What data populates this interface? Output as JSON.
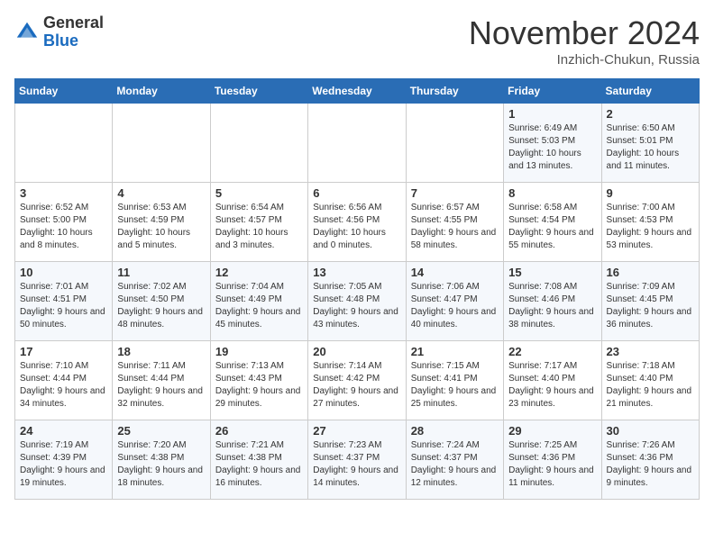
{
  "header": {
    "logo_general": "General",
    "logo_blue": "Blue",
    "month_title": "November 2024",
    "subtitle": "Inzhich-Chukun, Russia"
  },
  "days_of_week": [
    "Sunday",
    "Monday",
    "Tuesday",
    "Wednesday",
    "Thursday",
    "Friday",
    "Saturday"
  ],
  "weeks": [
    [
      {
        "day": "",
        "info": ""
      },
      {
        "day": "",
        "info": ""
      },
      {
        "day": "",
        "info": ""
      },
      {
        "day": "",
        "info": ""
      },
      {
        "day": "",
        "info": ""
      },
      {
        "day": "1",
        "info": "Sunrise: 6:49 AM\nSunset: 5:03 PM\nDaylight: 10 hours and 13 minutes."
      },
      {
        "day": "2",
        "info": "Sunrise: 6:50 AM\nSunset: 5:01 PM\nDaylight: 10 hours and 11 minutes."
      }
    ],
    [
      {
        "day": "3",
        "info": "Sunrise: 6:52 AM\nSunset: 5:00 PM\nDaylight: 10 hours and 8 minutes."
      },
      {
        "day": "4",
        "info": "Sunrise: 6:53 AM\nSunset: 4:59 PM\nDaylight: 10 hours and 5 minutes."
      },
      {
        "day": "5",
        "info": "Sunrise: 6:54 AM\nSunset: 4:57 PM\nDaylight: 10 hours and 3 minutes."
      },
      {
        "day": "6",
        "info": "Sunrise: 6:56 AM\nSunset: 4:56 PM\nDaylight: 10 hours and 0 minutes."
      },
      {
        "day": "7",
        "info": "Sunrise: 6:57 AM\nSunset: 4:55 PM\nDaylight: 9 hours and 58 minutes."
      },
      {
        "day": "8",
        "info": "Sunrise: 6:58 AM\nSunset: 4:54 PM\nDaylight: 9 hours and 55 minutes."
      },
      {
        "day": "9",
        "info": "Sunrise: 7:00 AM\nSunset: 4:53 PM\nDaylight: 9 hours and 53 minutes."
      }
    ],
    [
      {
        "day": "10",
        "info": "Sunrise: 7:01 AM\nSunset: 4:51 PM\nDaylight: 9 hours and 50 minutes."
      },
      {
        "day": "11",
        "info": "Sunrise: 7:02 AM\nSunset: 4:50 PM\nDaylight: 9 hours and 48 minutes."
      },
      {
        "day": "12",
        "info": "Sunrise: 7:04 AM\nSunset: 4:49 PM\nDaylight: 9 hours and 45 minutes."
      },
      {
        "day": "13",
        "info": "Sunrise: 7:05 AM\nSunset: 4:48 PM\nDaylight: 9 hours and 43 minutes."
      },
      {
        "day": "14",
        "info": "Sunrise: 7:06 AM\nSunset: 4:47 PM\nDaylight: 9 hours and 40 minutes."
      },
      {
        "day": "15",
        "info": "Sunrise: 7:08 AM\nSunset: 4:46 PM\nDaylight: 9 hours and 38 minutes."
      },
      {
        "day": "16",
        "info": "Sunrise: 7:09 AM\nSunset: 4:45 PM\nDaylight: 9 hours and 36 minutes."
      }
    ],
    [
      {
        "day": "17",
        "info": "Sunrise: 7:10 AM\nSunset: 4:44 PM\nDaylight: 9 hours and 34 minutes."
      },
      {
        "day": "18",
        "info": "Sunrise: 7:11 AM\nSunset: 4:44 PM\nDaylight: 9 hours and 32 minutes."
      },
      {
        "day": "19",
        "info": "Sunrise: 7:13 AM\nSunset: 4:43 PM\nDaylight: 9 hours and 29 minutes."
      },
      {
        "day": "20",
        "info": "Sunrise: 7:14 AM\nSunset: 4:42 PM\nDaylight: 9 hours and 27 minutes."
      },
      {
        "day": "21",
        "info": "Sunrise: 7:15 AM\nSunset: 4:41 PM\nDaylight: 9 hours and 25 minutes."
      },
      {
        "day": "22",
        "info": "Sunrise: 7:17 AM\nSunset: 4:40 PM\nDaylight: 9 hours and 23 minutes."
      },
      {
        "day": "23",
        "info": "Sunrise: 7:18 AM\nSunset: 4:40 PM\nDaylight: 9 hours and 21 minutes."
      }
    ],
    [
      {
        "day": "24",
        "info": "Sunrise: 7:19 AM\nSunset: 4:39 PM\nDaylight: 9 hours and 19 minutes."
      },
      {
        "day": "25",
        "info": "Sunrise: 7:20 AM\nSunset: 4:38 PM\nDaylight: 9 hours and 18 minutes."
      },
      {
        "day": "26",
        "info": "Sunrise: 7:21 AM\nSunset: 4:38 PM\nDaylight: 9 hours and 16 minutes."
      },
      {
        "day": "27",
        "info": "Sunrise: 7:23 AM\nSunset: 4:37 PM\nDaylight: 9 hours and 14 minutes."
      },
      {
        "day": "28",
        "info": "Sunrise: 7:24 AM\nSunset: 4:37 PM\nDaylight: 9 hours and 12 minutes."
      },
      {
        "day": "29",
        "info": "Sunrise: 7:25 AM\nSunset: 4:36 PM\nDaylight: 9 hours and 11 minutes."
      },
      {
        "day": "30",
        "info": "Sunrise: 7:26 AM\nSunset: 4:36 PM\nDaylight: 9 hours and 9 minutes."
      }
    ]
  ]
}
